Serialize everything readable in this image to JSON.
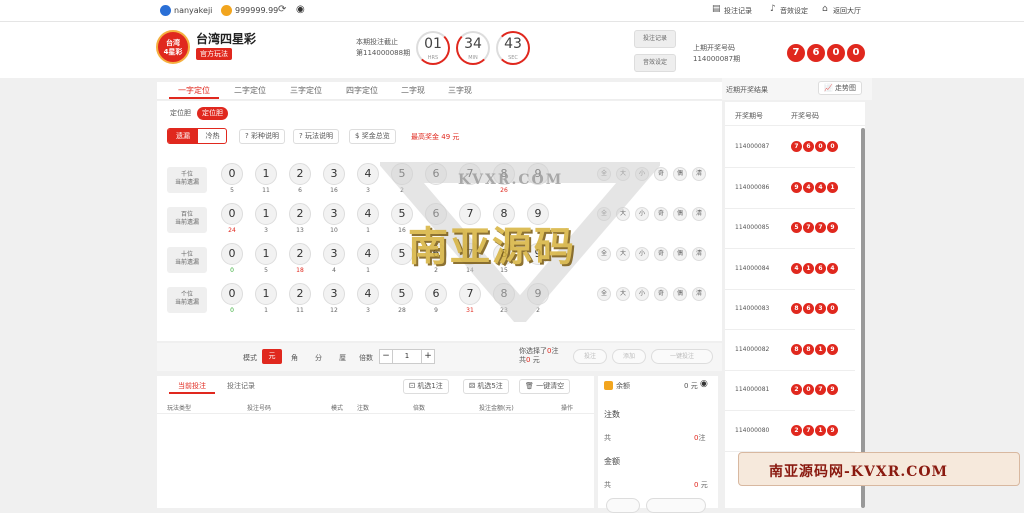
{
  "topbar": {
    "username": "nanyakeji",
    "balance": "999999.99",
    "links": [
      "投注记录",
      "音效设定",
      "返回大厅"
    ]
  },
  "header": {
    "logo_text": "台湾\n4星彩",
    "game_name": "台湾四星彩",
    "badge": "官方玩法",
    "deadline_label": "本期投注截止",
    "period": "第114000088期",
    "timer": [
      {
        "value": "01",
        "unit": "HRS"
      },
      {
        "value": "34",
        "unit": "MIN"
      },
      {
        "value": "43",
        "unit": "SEC"
      }
    ],
    "quick_buttons": [
      "投注记录",
      "音效设定"
    ],
    "last_label": "上期开奖号码",
    "last_period": "114000087期",
    "last_numbers": [
      "7",
      "6",
      "0",
      "0"
    ]
  },
  "play_tabs": [
    "一字定位",
    "二字定位",
    "三字定位",
    "四字定位",
    "二字现",
    "三字现"
  ],
  "sub_tabs": [
    "定位胆",
    "定位胆"
  ],
  "toggle": [
    "遗漏",
    "冷热"
  ],
  "info_buttons": [
    "彩种说明",
    "玩法说明",
    "奖金总览"
  ],
  "max_prize_label": "最高奖金",
  "max_prize": "49 元",
  "rows": [
    {
      "name": "千位",
      "sub": "当前遗漏",
      "miss": [
        "5",
        "11",
        "6",
        "16",
        "3",
        "2",
        "",
        "",
        "26",
        ""
      ],
      "colors": [
        "",
        "",
        "",
        "",
        "",
        "",
        "",
        "",
        "red",
        ""
      ]
    },
    {
      "name": "百位",
      "sub": "当前遗漏",
      "miss": [
        "24",
        "3",
        "13",
        "10",
        "1",
        "16",
        "",
        "",
        "",
        ""
      ],
      "colors": [
        "red",
        "",
        "",
        "",
        "",
        "",
        "",
        "",
        "",
        ""
      ]
    },
    {
      "name": "十位",
      "sub": "当前遗漏",
      "miss": [
        "0",
        "5",
        "18",
        "4",
        "1",
        "",
        "2",
        "14",
        "15",
        ""
      ],
      "colors": [
        "green",
        "",
        "red",
        "",
        "",
        "",
        "",
        "",
        "",
        ""
      ]
    },
    {
      "name": "个位",
      "sub": "当前遗漏",
      "miss": [
        "0",
        "1",
        "11",
        "12",
        "3",
        "28",
        "9",
        "31",
        "23",
        "2"
      ],
      "colors": [
        "green",
        "",
        "",
        "",
        "",
        "",
        "",
        "red",
        "",
        ""
      ]
    }
  ],
  "digits": [
    "0",
    "1",
    "2",
    "3",
    "4",
    "5",
    "6",
    "7",
    "8",
    "9"
  ],
  "side_buttons": [
    "全",
    "大",
    "小",
    "奇",
    "偶",
    "清"
  ],
  "mode": {
    "label": "模式",
    "options": [
      "元",
      "角",
      "分",
      "厘"
    ],
    "multiple_label": "倍数",
    "multiple": "1"
  },
  "selection": {
    "text1": "你选择了",
    "count": "0",
    "unit1": "注",
    "text2": "共",
    "amount": "0",
    "unit2": "元"
  },
  "action_buttons": [
    "投注",
    "添加",
    "一键投注"
  ],
  "bet_tabs": [
    "当前投注",
    "投注记录"
  ],
  "bet_buttons": [
    "机选1注",
    "机选5注",
    "一键清空"
  ],
  "bet_columns": [
    "玩法类型",
    "投注号码",
    "模式",
    "注数",
    "倍数",
    "投注金额(元)",
    "操作"
  ],
  "summary": {
    "balance_label": "余额",
    "balance": "0",
    "balance_unit": "元",
    "zhu_label": "注数",
    "total_label": "共",
    "zhu_value": "0",
    "zhu_unit": "注",
    "amount_label": "金额",
    "amount_value": "0",
    "amount_unit": "元"
  },
  "history": {
    "title": "近期开奖结果",
    "trend_btn": "走势图",
    "col1": "开奖期号",
    "col2": "开奖号码",
    "items": [
      {
        "period": "114000087",
        "nums": [
          "7",
          "6",
          "0",
          "0"
        ]
      },
      {
        "period": "114000086",
        "nums": [
          "9",
          "4",
          "4",
          "1"
        ]
      },
      {
        "period": "114000085",
        "nums": [
          "5",
          "7",
          "7",
          "9"
        ]
      },
      {
        "period": "114000084",
        "nums": [
          "4",
          "1",
          "6",
          "4"
        ]
      },
      {
        "period": "114000083",
        "nums": [
          "8",
          "6",
          "3",
          "0"
        ]
      },
      {
        "period": "114000082",
        "nums": [
          "8",
          "8",
          "1",
          "9"
        ]
      },
      {
        "period": "114000081",
        "nums": [
          "2",
          "0",
          "7",
          "9"
        ]
      },
      {
        "period": "114000080",
        "nums": [
          "2",
          "7",
          "1",
          "9"
        ]
      }
    ]
  },
  "watermark": {
    "top": "KVXR.COM",
    "main": "南亚源码",
    "banner": "南亚源码网-KVXR.COM"
  }
}
